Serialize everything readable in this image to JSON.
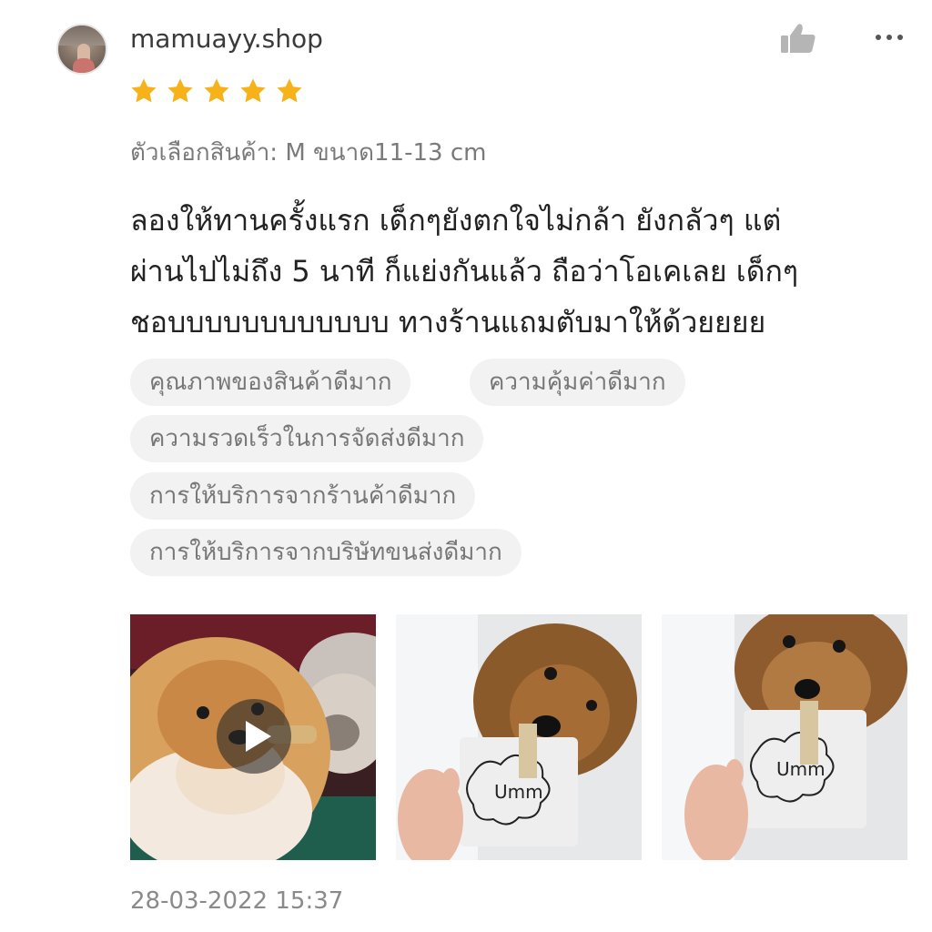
{
  "review": {
    "username": "mamuayy.shop",
    "rating": 5,
    "variation": "ตัวเลือกสินค้า: M ขนาด11-13 cm",
    "text_lines": [
      "ลองให้ทานครั้งแรก เด็กๆยังตกใจไม่กล้า ยังกลัวๆ แต่",
      "ผ่านไปไม่ถึง 5 นาที ก็แย่งกันแล้ว ถือว่าโอเคเลย เด็กๆ",
      "ชอบบบบบบบบบบบบ ทางร้านแถมตับมาให้ด้วยยยย"
    ],
    "tags": [
      "คุณภาพของสินค้าดีมาก",
      "ความคุ้มค่าดีมาก",
      "ความรวดเร็วในการจัดส่งดีมาก",
      "การให้บริการจากร้านค้าดีมาก",
      "การให้บริการจากบริษัทขนส่งดีมาก"
    ],
    "media_label": "Umm",
    "timestamp": "28-03-2022 15:37"
  },
  "icons": {
    "like": "thumbs-up-icon",
    "more": "more-options-icon",
    "star": "star-icon",
    "play": "play-icon"
  },
  "colors": {
    "star": "#f7b21a",
    "icon_gray": "#b5b5b5",
    "tag_bg": "#f2f2f2"
  }
}
